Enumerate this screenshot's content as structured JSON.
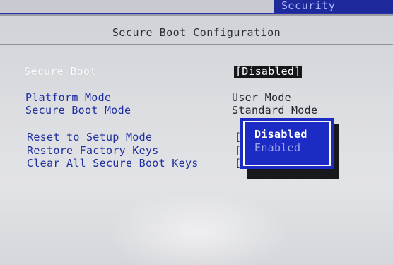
{
  "header": {
    "tab_label": "Security"
  },
  "page": {
    "title": "Secure Boot Configuration"
  },
  "settings": [
    {
      "label": "Secure Boot",
      "value": "[Disabled]"
    },
    {
      "label": "Platform Mode",
      "value": "User Mode"
    },
    {
      "label": "Secure Boot Mode",
      "value": "Standard Mode"
    },
    {
      "label": "Reset to Setup Mode",
      "value": "["
    },
    {
      "label": "Restore Factory Keys",
      "value": "["
    },
    {
      "label": "Clear All Secure Boot Keys",
      "value": "["
    }
  ],
  "popup": {
    "options": [
      "Disabled",
      "Enabled"
    ],
    "selected": "Disabled"
  },
  "colors": {
    "bios_blue": "#1c2bc4",
    "label_blue": "#1f2f9f",
    "background": "#d8d9dd"
  }
}
